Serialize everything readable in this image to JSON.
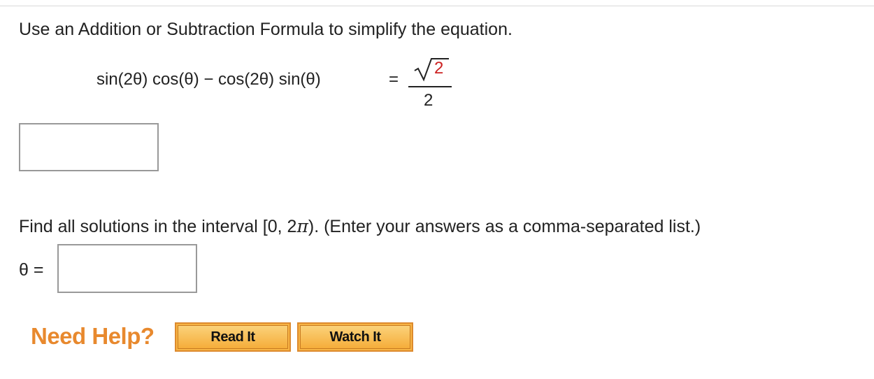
{
  "problem": {
    "prompt": "Use an Addition or Subtraction Formula to simplify the equation.",
    "equation": {
      "lhs": "sin(2θ) cos(θ)  −  cos(2θ) sin(θ)",
      "equals": "=",
      "numerator_radicand": "2",
      "denominator": "2"
    },
    "answer1_value": "",
    "question2_before": "Find all solutions in the interval [0, 2",
    "question2_pi": "π",
    "question2_after": "). (Enter your answers as a comma-separated list.)",
    "theta_label": "θ  =",
    "answer2_value": ""
  },
  "help": {
    "label": "Need Help?",
    "read_it": "Read It",
    "watch_it": "Watch It"
  },
  "colors": {
    "accent": "#e8892e",
    "button_fill": "#f7b444",
    "radicand": "#cc2222"
  }
}
